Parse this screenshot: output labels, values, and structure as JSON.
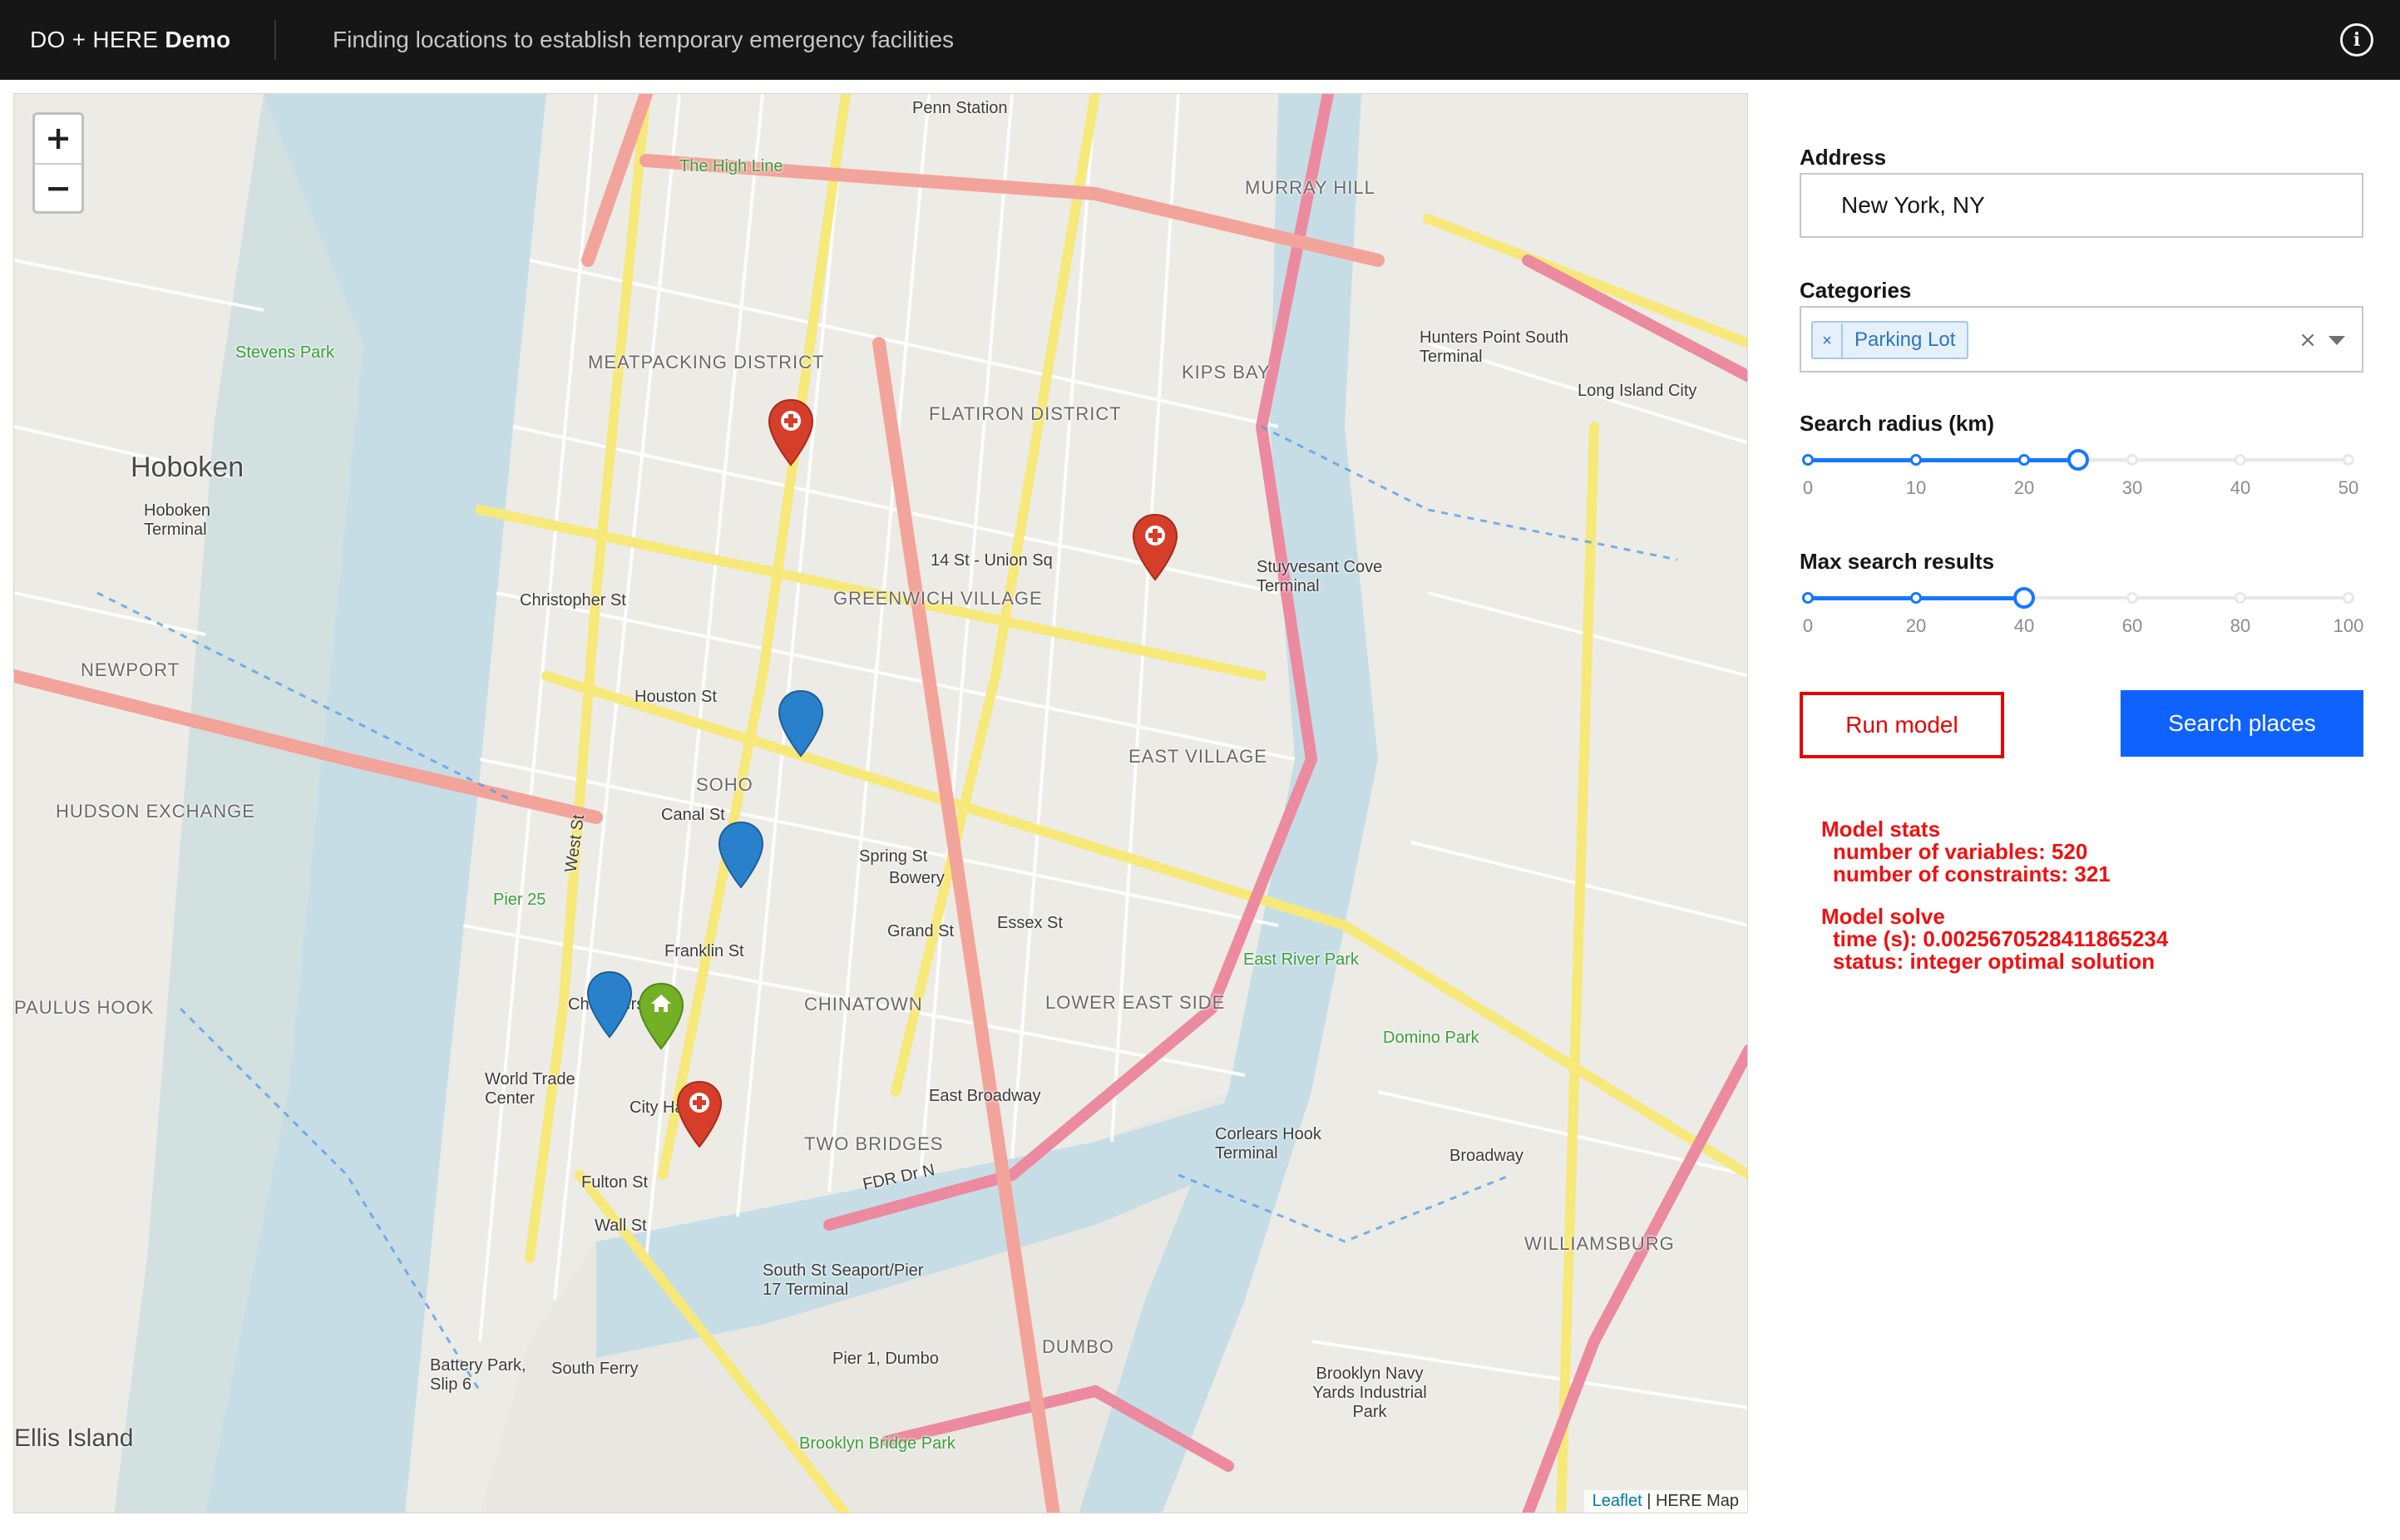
{
  "header": {
    "brand_light": "DO + HERE",
    "brand_bold": "Demo",
    "subtitle": "Finding locations to establish temporary emergency facilities",
    "info_icon": "information-circle-icon",
    "info_glyph": "i"
  },
  "map": {
    "zoom_in": "+",
    "zoom_out": "−",
    "attribution_link": "Leaflet",
    "attribution_rest": " | HERE Map",
    "labels": {
      "hoboken": "Hoboken",
      "soho": "SOHO",
      "greenwich_village": "GREENWICH VILLAGE",
      "east_village": "EAST VILLAGE",
      "chinatown": "CHINATOWN",
      "lower_east_side": "LOWER EAST SIDE",
      "two_bridges": "TWO BRIDGES",
      "dumbo": "DUMBO",
      "williamsburg": "WILLIAMSBURG",
      "meatpacking": "MEATPACKING DISTRICT",
      "flatiron": "FLATIRON DISTRICT",
      "kips_bay": "KIPS BAY",
      "murray_hill": "MURRAY HILL",
      "hudson_exchange": "HUDSON EXCHANGE",
      "newport": "NEWPORT",
      "paulus_hook": "PAULUS HOOK",
      "pier_25": "Pier 25",
      "east_river_park": "East River Park",
      "brooklyn_bridge_park": "Brooklyn Bridge Park",
      "stevens_park": "Stevens Park",
      "the_high_line": "The High Line",
      "long_island_city": "Long Island City",
      "broadway": "Broadway",
      "fdr_dr": "FDR Dr N",
      "west_st": "West St",
      "canal_st": "Canal St",
      "spring_st": "Spring St",
      "houston_st": "Houston St",
      "bowery": "Bowery",
      "essex_st": "Essex St",
      "grand_st": "Grand St",
      "east_broadway": "East Broadway",
      "fulton_st": "Fulton St",
      "wall_st": "Wall St",
      "south_ferry": "South Ferry",
      "battery_park": "Battery Park, Slip 6",
      "ellis_island": "Ellis Island",
      "world_trade_center": "World Trade Center",
      "chambers_st": "Chambers St",
      "franklin_st": "Franklin St",
      "christopher_st": "Christopher St",
      "union_sq": "14 St - Union Sq",
      "stuyvesant_cove": "Stuyvesant Cove Terminal",
      "penn_station": "Penn Station",
      "hoboken_terminal": "Hoboken Terminal",
      "brooklyn_navy_yard": "Brooklyn Navy Yards Industrial Park",
      "domino_park": "Domino Park",
      "city_hall": "City Hall",
      "hunters_point": "Hunters Point South Terminal",
      "corlears_hook": "Corlears Hook Terminal",
      "pier_1": "Pier 1, Dumbo",
      "south_st_seaport": "South St Seaport/Pier 17 Terminal"
    },
    "markers": [
      {
        "name": "hospital-marker-1",
        "color": "#d63e2a",
        "icon": "hospital-icon"
      },
      {
        "name": "hospital-marker-2",
        "color": "#d63e2a",
        "icon": "hospital-icon"
      },
      {
        "name": "hospital-marker-3",
        "color": "#d63e2a",
        "icon": "hospital-icon"
      },
      {
        "name": "parking-marker-1",
        "color": "#2a81cb",
        "icon": "location-icon"
      },
      {
        "name": "parking-marker-2",
        "color": "#2a81cb",
        "icon": "location-icon"
      },
      {
        "name": "parking-marker-3",
        "color": "#2a81cb",
        "icon": "location-icon"
      },
      {
        "name": "home-marker",
        "color": "#72b026",
        "icon": "home-icon"
      }
    ]
  },
  "sidebar": {
    "address_label": "Address",
    "address_value": "New York, NY",
    "categories_label": "Categories",
    "category_tag": "Parking Lot",
    "tag_remove_glyph": "×",
    "clear_glyph": "×",
    "radius_label": "Search radius (km)",
    "radius_ticks": [
      "0",
      "10",
      "20",
      "30",
      "40",
      "50"
    ],
    "radius_value": 25,
    "radius_max": 50,
    "max_results_label": "Max search results",
    "max_results_ticks": [
      "0",
      "20",
      "40",
      "60",
      "80",
      "100"
    ],
    "max_results_value": 40,
    "max_results_max": 100,
    "run_model_label": "Run model",
    "search_places_label": "Search places",
    "accent_color": "#0f62fe",
    "run_color": "#e60000"
  },
  "stats": {
    "model_stats_title": "Model stats",
    "variables": "number of variables: 520",
    "constraints": "number of constraints: 321",
    "model_solve_title": "Model solve",
    "time": "time (s): 0.0025670528411865234",
    "status": "status: integer optimal solution"
  }
}
